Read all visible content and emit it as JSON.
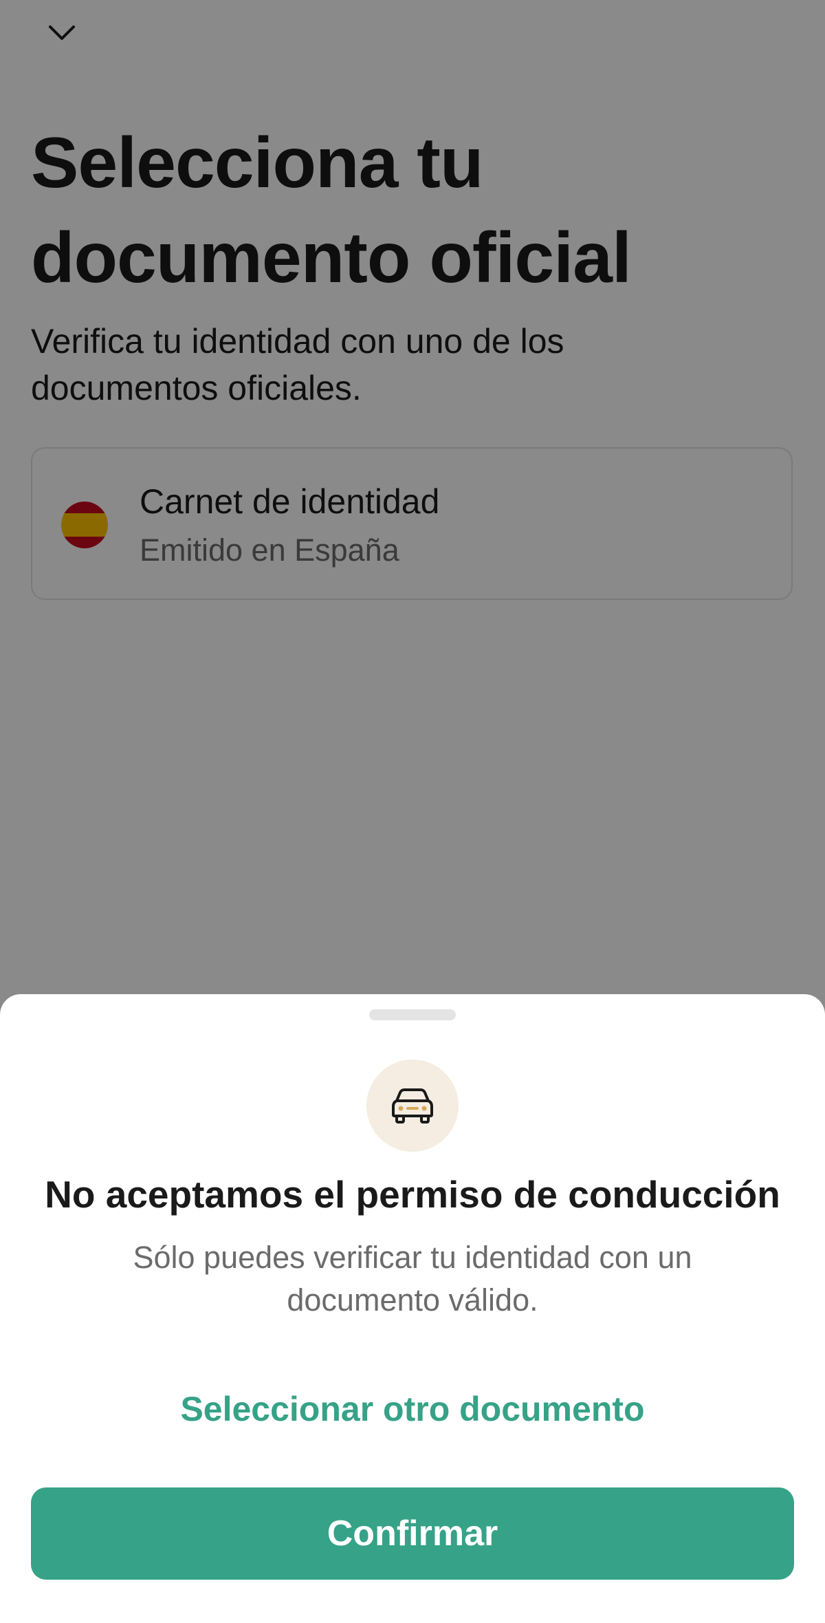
{
  "page": {
    "title": "Selecciona tu documento oficial",
    "subtitle": "Verifica tu identidad con uno de los documentos oficiales.",
    "collapse_icon": "chevron-down-icon",
    "documents": [
      {
        "name": "Carnet de identidad",
        "issuer": "Emitido en España",
        "flag_icon": "spain-flag-icon"
      }
    ]
  },
  "sheet": {
    "icon": "car-icon",
    "title": "No aceptamos el permiso de conducción",
    "text": "Sólo puedes verificar tu identidad con un documento válido.",
    "secondary_label": "Seleccionar otro documento",
    "primary_label": "Confirmar"
  },
  "colors": {
    "accent": "#36a287",
    "icon_circle_bg": "#f5ede1",
    "icon_accent": "#d6a85a",
    "scrim": "rgba(0,0,0,0.46)"
  }
}
